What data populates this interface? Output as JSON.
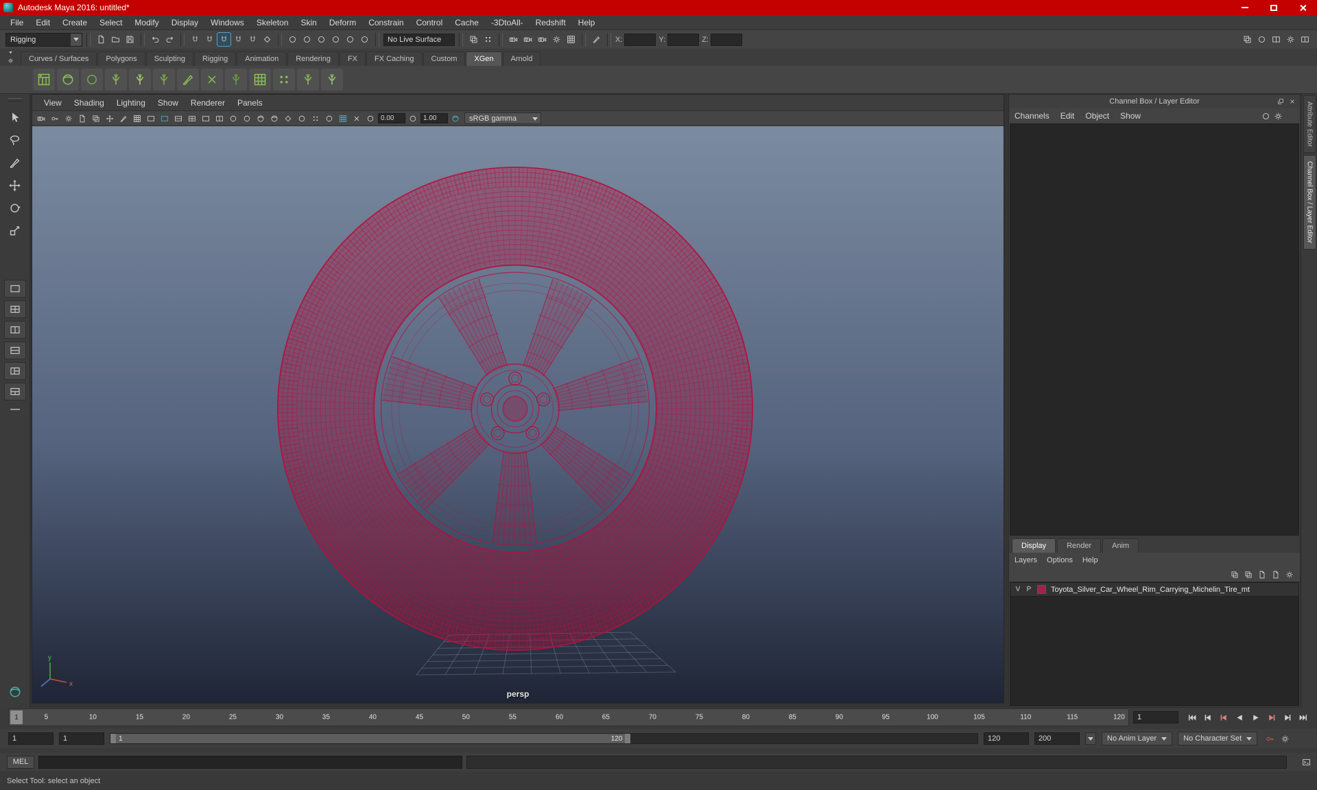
{
  "window": {
    "title": "Autodesk Maya 2016: untitled*",
    "titlebar_color": "#c40000"
  },
  "menubar": {
    "items": [
      "File",
      "Edit",
      "Create",
      "Select",
      "Modify",
      "Display",
      "Windows",
      "Skeleton",
      "Skin",
      "Deform",
      "Constrain",
      "Control",
      "Cache",
      "-3DtoAll-",
      "Redshift",
      "Help"
    ]
  },
  "statusline": {
    "menuset": "Rigging",
    "live_surface": "No Live Surface",
    "coord_labels": {
      "x": "X:",
      "y": "Y:",
      "z": "Z:"
    },
    "groups": [
      {
        "name": "file-operations",
        "icons": [
          {
            "name": "new-scene-icon",
            "glyph": "page"
          },
          {
            "name": "open-scene-icon",
            "glyph": "folder"
          },
          {
            "name": "save-scene-icon",
            "glyph": "floppy"
          }
        ]
      },
      {
        "name": "undo-redo",
        "icons": [
          {
            "name": "undo-icon",
            "glyph": "undo"
          },
          {
            "name": "redo-icon",
            "glyph": "redo"
          }
        ]
      },
      {
        "name": "snapping",
        "icons": [
          {
            "name": "snap-to-grids-icon",
            "glyph": "magnet"
          },
          {
            "name": "snap-to-curves-icon",
            "glyph": "magnet"
          },
          {
            "name": "snap-to-points-icon",
            "glyph": "magnet",
            "active": true
          },
          {
            "name": "snap-to-projected-center-icon",
            "glyph": "magnet"
          },
          {
            "name": "snap-to-view-planes-icon",
            "glyph": "magnet"
          },
          {
            "name": "make-object-live-icon",
            "glyph": "live"
          }
        ]
      },
      {
        "name": "history",
        "icons": [
          {
            "name": "input-to-selected-icon",
            "glyph": "circle"
          },
          {
            "name": "output-from-selected-icon",
            "glyph": "circle"
          },
          {
            "name": "input-output-connections-icon",
            "glyph": "circle"
          },
          {
            "name": "construction-history-icon",
            "glyph": "circle"
          },
          {
            "name": "highlight-selection-mode-icon",
            "glyph": "circle"
          },
          {
            "name": "object-details-icon",
            "glyph": "circle"
          }
        ]
      },
      {
        "name": "selection-mask",
        "icons": [
          {
            "name": "select-by-hierarchy-icon",
            "glyph": "layers"
          },
          {
            "name": "select-by-component-icon",
            "glyph": "dotgrid"
          }
        ]
      },
      {
        "name": "rendering",
        "icons": [
          {
            "name": "open-render-view-icon",
            "glyph": "cam"
          },
          {
            "name": "render-current-frame-icon",
            "glyph": "cam"
          },
          {
            "name": "ipr-render-icon",
            "glyph": "cam"
          },
          {
            "name": "render-settings-icon",
            "glyph": "gear"
          },
          {
            "name": "display-quality-icon",
            "glyph": "grid3"
          }
        ]
      },
      {
        "name": "paint-effects",
        "icons": [
          {
            "name": "paint-effects-icon",
            "glyph": "brush"
          }
        ]
      }
    ],
    "right_icons": [
      {
        "name": "toggle-modeling-toolkit-icon",
        "glyph": "layers"
      },
      {
        "name": "toggle-humanik-icon",
        "glyph": "circle"
      },
      {
        "name": "toggle-attribute-editor-icon",
        "glyph": "pane2v"
      },
      {
        "name": "toggle-tool-settings-icon",
        "glyph": "gear"
      },
      {
        "name": "toggle-channel-box-icon",
        "glyph": "pane2v"
      }
    ]
  },
  "shelf": {
    "controls": [
      {
        "name": "shelf-tab-arrow-icon",
        "glyph": "trid"
      },
      {
        "name": "shelf-options-icon",
        "glyph": "gear"
      }
    ],
    "tabs": [
      "Curves / Surfaces",
      "Polygons",
      "Sculpting",
      "Rigging",
      "Animation",
      "Rendering",
      "FX",
      "FX Caching",
      "Custom",
      "XGen",
      "Arnold"
    ],
    "active_tab": "XGen",
    "icons": [
      {
        "name": "xgen-editor-icon",
        "glyph": "xsheet",
        "color": "#8cc152"
      },
      {
        "name": "sphere-hair-icon",
        "glyph": "sphere",
        "color": "#8cc152"
      },
      {
        "name": "green-surface-icon",
        "glyph": "circle",
        "color": "#6fae3e"
      },
      {
        "name": "grass-clump-icon",
        "glyph": "plant",
        "color": "#8cc152"
      },
      {
        "name": "grass-add-icon",
        "glyph": "plant",
        "color": "#a8d468"
      },
      {
        "name": "guide-curve-icon",
        "glyph": "plant",
        "color": "#7fb548"
      },
      {
        "name": "comb-guides-icon",
        "glyph": "brush",
        "color": "#8cc152"
      },
      {
        "name": "trim-guides-icon",
        "glyph": "cross",
        "color": "#8cc152"
      },
      {
        "name": "groom-splines-icon",
        "glyph": "plant",
        "color": "#69a33c"
      },
      {
        "name": "region-map-icon",
        "glyph": "grid3",
        "color": "#8cc152"
      },
      {
        "name": "density-mask-icon",
        "glyph": "dotgrid",
        "color": "#8cc152"
      },
      {
        "name": "clump-map-icon",
        "glyph": "plant",
        "color": "#8cc152"
      },
      {
        "name": "wind-effect-icon",
        "glyph": "plant",
        "color": "#9cc86a"
      }
    ]
  },
  "toolbox": {
    "tools": [
      {
        "name": "select-tool-icon",
        "glyph": "cursor"
      },
      {
        "name": "lasso-tool-icon",
        "glyph": "lasso"
      },
      {
        "name": "paint-selection-tool-icon",
        "glyph": "brush"
      },
      {
        "name": "move-tool-icon",
        "glyph": "move"
      },
      {
        "name": "rotate-tool-icon",
        "glyph": "rotate"
      },
      {
        "name": "scale-tool-icon",
        "glyph": "scale"
      }
    ],
    "layouts": [
      {
        "name": "layout-single-pane-button",
        "glyph": "pane1"
      },
      {
        "name": "layout-four-pane-button",
        "glyph": "pane4"
      },
      {
        "name": "layout-two-pane-side-button",
        "glyph": "pane2v"
      },
      {
        "name": "layout-two-pane-stacked-button",
        "glyph": "pane2h"
      },
      {
        "name": "layout-three-pane-button",
        "glyph": "pane3"
      },
      {
        "name": "layout-outliner-persp-button",
        "glyph": "pane3b"
      }
    ],
    "logo": [
      {
        "name": "maya-toolbox-logo-icon",
        "glyph": "sphere",
        "color": "#3db8a5"
      }
    ]
  },
  "viewport": {
    "menus": [
      "View",
      "Shading",
      "Lighting",
      "Show",
      "Renderer",
      "Panels"
    ],
    "toolbar_icons": [
      {
        "name": "select-camera-icon",
        "glyph": "cam"
      },
      {
        "name": "lock-camera-icon",
        "glyph": "key"
      },
      {
        "name": "camera-attributes-icon",
        "glyph": "gear"
      },
      {
        "name": "bookmarks-icon",
        "glyph": "page"
      },
      {
        "name": "image-plane-icon",
        "glyph": "layers"
      },
      {
        "name": "2d-pan-zoom-icon",
        "glyph": "move"
      },
      {
        "name": "grease-pencil-icon",
        "glyph": "brush"
      },
      {
        "name": "grid-toggle-icon",
        "glyph": "grid3"
      },
      {
        "name": "film-gate-icon",
        "glyph": "pane1"
      },
      {
        "name": "resolution-gate-icon",
        "glyph": "pane1",
        "color": "#57a7b5"
      },
      {
        "name": "gate-mask-icon",
        "glyph": "pane2h"
      },
      {
        "name": "field-chart-icon",
        "glyph": "pane4"
      },
      {
        "name": "safe-action-icon",
        "glyph": "pane1"
      },
      {
        "name": "safe-title-icon",
        "glyph": "pane2v"
      },
      {
        "name": "frame-all-icon",
        "glyph": "circle"
      },
      {
        "name": "wireframe-display-icon",
        "glyph": "circle"
      },
      {
        "name": "shaded-display-icon",
        "glyph": "sphere"
      },
      {
        "name": "textured-display-icon",
        "glyph": "sphere"
      },
      {
        "name": "use-all-lights-icon",
        "glyph": "live"
      },
      {
        "name": "shadows-icon",
        "glyph": "circle"
      },
      {
        "name": "screen-space-ao-icon",
        "glyph": "dotgrid"
      },
      {
        "name": "motion-blur-icon",
        "glyph": "circle"
      },
      {
        "name": "multisample-aa-icon",
        "glyph": "grid3",
        "color": "#57a7b5"
      },
      {
        "name": "isolate-select-icon",
        "glyph": "cross"
      }
    ],
    "exposure_icon": [
      {
        "name": "exposure-icon",
        "glyph": "circle"
      }
    ],
    "exposure": "0.00",
    "gamma_icon": [
      {
        "name": "gamma-icon",
        "glyph": "circle"
      }
    ],
    "gamma": "1.00",
    "colorspace_icon": [
      {
        "name": "view-transform-icon",
        "glyph": "sphere",
        "color": "#57a7b5"
      }
    ],
    "colorspace": "sRGB gamma",
    "camera": "persp",
    "wireframe_color": "#b5103c",
    "bg_top": "#7b8ba0",
    "bg_mid": "#55637e",
    "bg_bottom": "#1f2536",
    "axis_labels": {
      "x": "x",
      "y": "y"
    }
  },
  "right_panel": {
    "title": "Channel Box / Layer Editor",
    "menus": [
      "Channels",
      "Edit",
      "Object",
      "Show"
    ],
    "header_icons": [
      {
        "name": "dock-panel-icon",
        "glyph": "float"
      },
      {
        "name": "close-panel-icon",
        "glyph": "cross"
      }
    ],
    "menu_icons": [
      {
        "name": "channel-slider-speed-icon",
        "glyph": "circle"
      },
      {
        "name": "channel-manipulator-icon",
        "glyph": "gear"
      }
    ],
    "vertical_tabs": [
      "Attribute Editor",
      "Channel Box / Layer Editor"
    ],
    "layer_editor": {
      "tabs": [
        "Display",
        "Render",
        "Anim"
      ],
      "active_tab": "Display",
      "menus": [
        "Layers",
        "Options",
        "Help"
      ],
      "icons": [
        {
          "name": "move-layer-up-icon",
          "glyph": "layers"
        },
        {
          "name": "move-layer-down-icon",
          "glyph": "layers"
        },
        {
          "name": "create-empty-layer-icon",
          "glyph": "page"
        },
        {
          "name": "create-layer-from-selected-icon",
          "glyph": "page"
        },
        {
          "name": "layer-options-icon",
          "glyph": "gear"
        }
      ],
      "layer": {
        "visibility": "V",
        "playback": "P",
        "color": "#a32052",
        "name": "Toyota_Silver_Car_Wheel_Rim_Carrying_Michelin_Tire_mt"
      }
    }
  },
  "timeline": {
    "playhead": "1",
    "ticks": [
      "5",
      "10",
      "15",
      "20",
      "25",
      "30",
      "35",
      "40",
      "45",
      "50",
      "55",
      "60",
      "65",
      "70",
      "75",
      "80",
      "85",
      "90",
      "95",
      "100",
      "105",
      "110",
      "115",
      "120"
    ],
    "current_frame": "1",
    "playback": [
      {
        "name": "go-to-start-button",
        "glyph": "jump",
        "flip": true
      },
      {
        "name": "step-back-frame-button",
        "glyph": "step",
        "flip": true
      },
      {
        "name": "step-back-key-button",
        "glyph": "step",
        "flip": true,
        "color": "#d98080"
      },
      {
        "name": "play-backwards-button",
        "glyph": "play",
        "flip": true
      },
      {
        "name": "play-forwards-button",
        "glyph": "play"
      },
      {
        "name": "step-forward-key-button",
        "glyph": "step",
        "color": "#d98080"
      },
      {
        "name": "step-forward-frame-button",
        "glyph": "step"
      },
      {
        "name": "go-to-end-button",
        "glyph": "jump"
      }
    ]
  },
  "range": {
    "anim_start": "1",
    "playback_start": "1",
    "handle_start": "1",
    "handle_end_label": "120",
    "playback_end": "120",
    "anim_end": "200",
    "anim_layer": "No Anim Layer",
    "character_set": "No Character Set",
    "icons": [
      {
        "name": "auto-keyframe-icon",
        "glyph": "key",
        "color": "#d25050"
      },
      {
        "name": "animation-preferences-icon",
        "glyph": "gear"
      }
    ]
  },
  "command_line": {
    "label": "MEL"
  },
  "help_line": {
    "text": "Select Tool: select an object"
  }
}
